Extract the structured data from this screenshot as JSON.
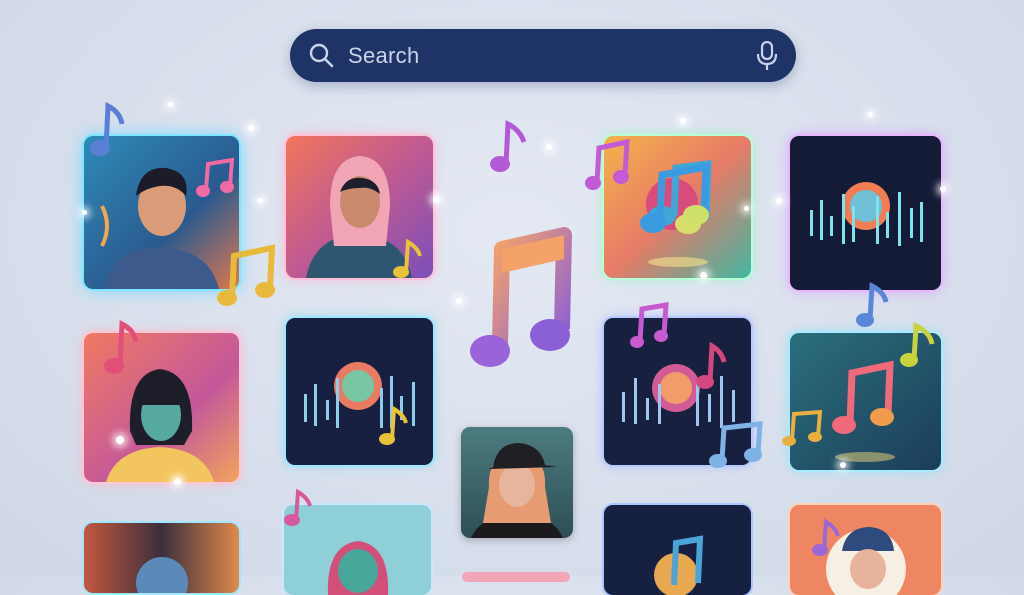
{
  "search": {
    "placeholder": "Search",
    "icon": "search-icon",
    "mic_icon": "microphone-icon"
  },
  "colors": {
    "search_bg": "#1f3466",
    "search_text": "#c9d3ea",
    "page_bg": "#dde3ee"
  },
  "tiles": [
    {
      "name": "portrait-man-gazing",
      "icon": "album-art"
    },
    {
      "name": "portrait-hooded-man",
      "icon": "album-art"
    },
    {
      "name": "music-note-orb-art",
      "icon": "album-art"
    },
    {
      "name": "equalizer-disc-art",
      "icon": "album-art"
    },
    {
      "name": "portrait-woman-bangs",
      "icon": "album-art"
    },
    {
      "name": "equalizer-disc-art-2",
      "icon": "album-art"
    },
    {
      "name": "photo-woman-cap",
      "icon": "album-art"
    },
    {
      "name": "equalizer-disc-art-3",
      "icon": "album-art"
    },
    {
      "name": "music-notes-art",
      "icon": "album-art"
    }
  ]
}
